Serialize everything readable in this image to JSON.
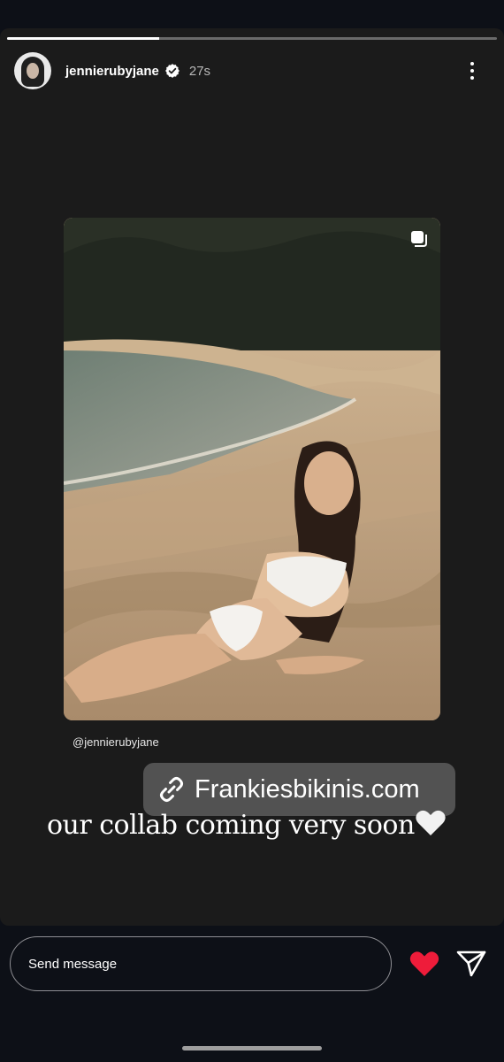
{
  "story": {
    "username": "jennierubyjane",
    "timestamp": "27s",
    "progress": 0.31
  },
  "post": {
    "mention": "@jennierubyjane",
    "link_text": "Frankiesbikinis.com",
    "caption": "our collab coming very soon",
    "caption_emoji": "white-heart-icon"
  },
  "composer": {
    "placeholder": "Send message"
  },
  "colors": {
    "like": "#ee1c3a",
    "background": "#1b1b1b",
    "sticker": "#5c5c5c"
  }
}
